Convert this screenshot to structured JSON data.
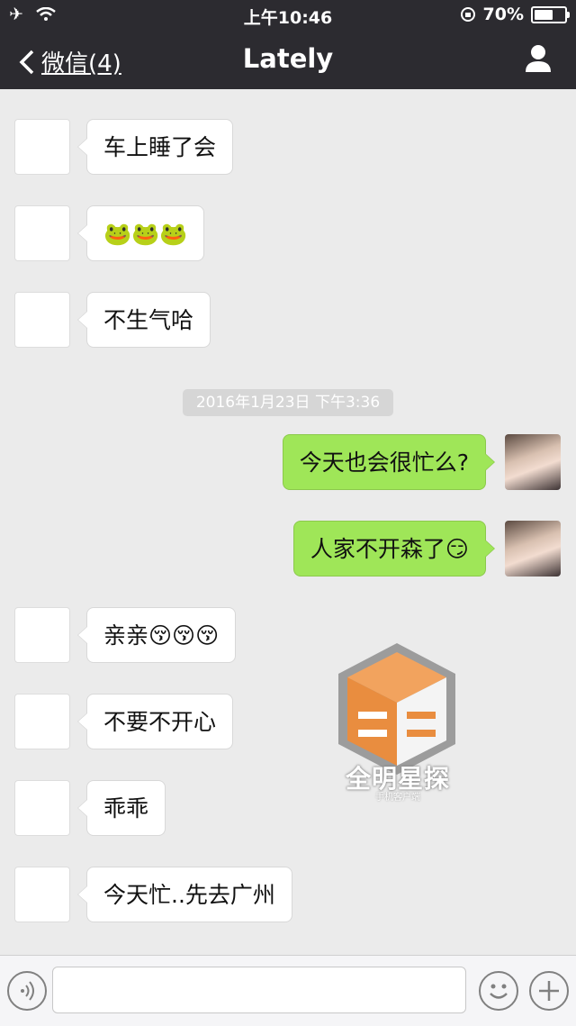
{
  "status_bar": {
    "time": "上午10:46",
    "battery": "70%",
    "battery_level": 0.7
  },
  "nav": {
    "back_label": "微信(4)",
    "title": "Lately"
  },
  "messages": [
    {
      "side": "in",
      "text": "车上睡了会"
    },
    {
      "side": "in",
      "text": "🐸🐸🐸"
    },
    {
      "side": "in",
      "text": "不生气哈"
    },
    {
      "side": "out",
      "text": "今天也会很忙么?"
    },
    {
      "side": "out",
      "text": "人家不开森了😏"
    },
    {
      "side": "in",
      "text": "亲亲😚😚😚"
    },
    {
      "side": "in",
      "text": "不要不开心"
    },
    {
      "side": "in",
      "text": "乖乖"
    },
    {
      "side": "in",
      "text": "今天忙..先去广州"
    }
  ],
  "timestamp": "2016年1月23日 下午3:36",
  "watermark": {
    "title": "全明星探",
    "subtitle": "手机客户端"
  },
  "colors": {
    "header": "#2c2b30",
    "background": "#ebebeb",
    "out_bubble": "#9fe658",
    "in_bubble": "#ffffff"
  }
}
